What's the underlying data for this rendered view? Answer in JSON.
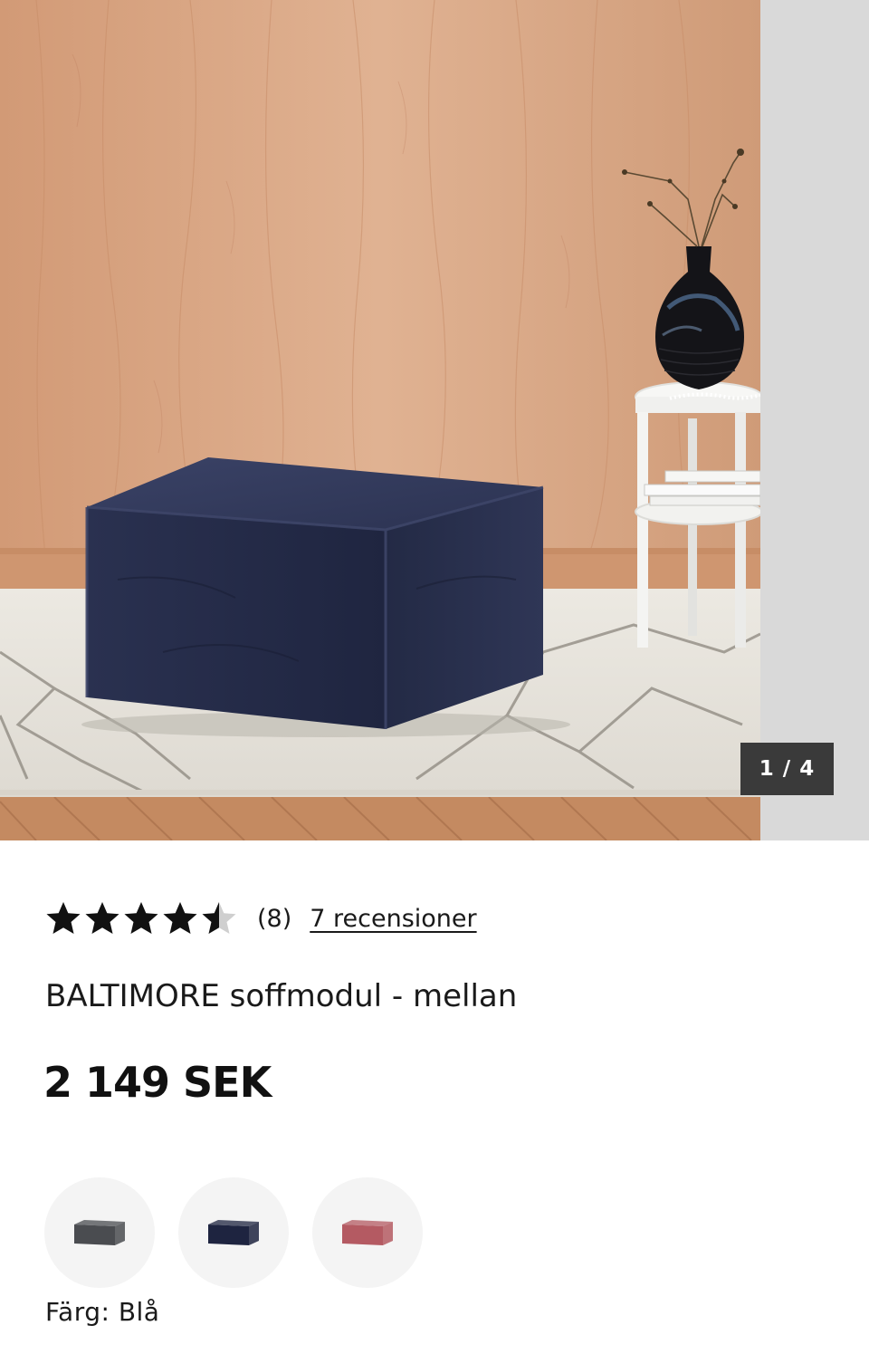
{
  "gallery": {
    "counter": {
      "current": "1",
      "separator": " / ",
      "total": "4"
    },
    "image_description_icon": "product-photo"
  },
  "rating": {
    "value": 4.5,
    "max": 5,
    "count_label": "(8)",
    "reviews_link": "7 recensioner",
    "star_color": "#111111",
    "star_empty_color": "#cfcfcf"
  },
  "product": {
    "title": "BALTIMORE soffmodul - mellan",
    "price": "2 149 SEK"
  },
  "swatches": [
    {
      "name": "gray",
      "color": "#4a4c50"
    },
    {
      "name": "blue",
      "color": "#1e2440"
    },
    {
      "name": "pink",
      "color": "#b45a62"
    }
  ],
  "color_selection": {
    "label": "Färg: Blå"
  }
}
